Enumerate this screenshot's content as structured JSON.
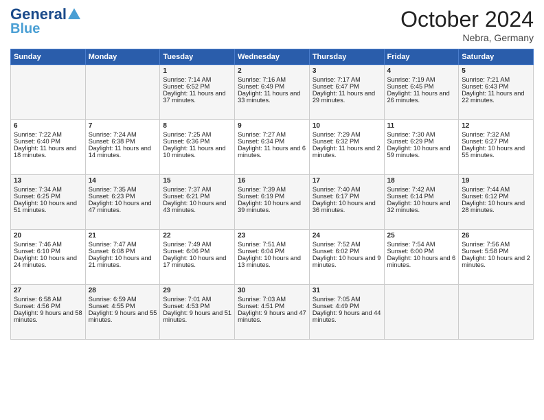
{
  "header": {
    "logo_general": "General",
    "logo_blue": "Blue",
    "month_title": "October 2024",
    "location": "Nebra, Germany"
  },
  "days_of_week": [
    "Sunday",
    "Monday",
    "Tuesday",
    "Wednesday",
    "Thursday",
    "Friday",
    "Saturday"
  ],
  "weeks": [
    {
      "days": [
        {
          "num": "",
          "info": ""
        },
        {
          "num": "",
          "info": ""
        },
        {
          "num": "1",
          "info": "Sunrise: 7:14 AM\nSunset: 6:52 PM\nDaylight: 11 hours and 37 minutes."
        },
        {
          "num": "2",
          "info": "Sunrise: 7:16 AM\nSunset: 6:49 PM\nDaylight: 11 hours and 33 minutes."
        },
        {
          "num": "3",
          "info": "Sunrise: 7:17 AM\nSunset: 6:47 PM\nDaylight: 11 hours and 29 minutes."
        },
        {
          "num": "4",
          "info": "Sunrise: 7:19 AM\nSunset: 6:45 PM\nDaylight: 11 hours and 26 minutes."
        },
        {
          "num": "5",
          "info": "Sunrise: 7:21 AM\nSunset: 6:43 PM\nDaylight: 11 hours and 22 minutes."
        }
      ]
    },
    {
      "days": [
        {
          "num": "6",
          "info": "Sunrise: 7:22 AM\nSunset: 6:40 PM\nDaylight: 11 hours and 18 minutes."
        },
        {
          "num": "7",
          "info": "Sunrise: 7:24 AM\nSunset: 6:38 PM\nDaylight: 11 hours and 14 minutes."
        },
        {
          "num": "8",
          "info": "Sunrise: 7:25 AM\nSunset: 6:36 PM\nDaylight: 11 hours and 10 minutes."
        },
        {
          "num": "9",
          "info": "Sunrise: 7:27 AM\nSunset: 6:34 PM\nDaylight: 11 hours and 6 minutes."
        },
        {
          "num": "10",
          "info": "Sunrise: 7:29 AM\nSunset: 6:32 PM\nDaylight: 11 hours and 2 minutes."
        },
        {
          "num": "11",
          "info": "Sunrise: 7:30 AM\nSunset: 6:29 PM\nDaylight: 10 hours and 59 minutes."
        },
        {
          "num": "12",
          "info": "Sunrise: 7:32 AM\nSunset: 6:27 PM\nDaylight: 10 hours and 55 minutes."
        }
      ]
    },
    {
      "days": [
        {
          "num": "13",
          "info": "Sunrise: 7:34 AM\nSunset: 6:25 PM\nDaylight: 10 hours and 51 minutes."
        },
        {
          "num": "14",
          "info": "Sunrise: 7:35 AM\nSunset: 6:23 PM\nDaylight: 10 hours and 47 minutes."
        },
        {
          "num": "15",
          "info": "Sunrise: 7:37 AM\nSunset: 6:21 PM\nDaylight: 10 hours and 43 minutes."
        },
        {
          "num": "16",
          "info": "Sunrise: 7:39 AM\nSunset: 6:19 PM\nDaylight: 10 hours and 39 minutes."
        },
        {
          "num": "17",
          "info": "Sunrise: 7:40 AM\nSunset: 6:17 PM\nDaylight: 10 hours and 36 minutes."
        },
        {
          "num": "18",
          "info": "Sunrise: 7:42 AM\nSunset: 6:14 PM\nDaylight: 10 hours and 32 minutes."
        },
        {
          "num": "19",
          "info": "Sunrise: 7:44 AM\nSunset: 6:12 PM\nDaylight: 10 hours and 28 minutes."
        }
      ]
    },
    {
      "days": [
        {
          "num": "20",
          "info": "Sunrise: 7:46 AM\nSunset: 6:10 PM\nDaylight: 10 hours and 24 minutes."
        },
        {
          "num": "21",
          "info": "Sunrise: 7:47 AM\nSunset: 6:08 PM\nDaylight: 10 hours and 21 minutes."
        },
        {
          "num": "22",
          "info": "Sunrise: 7:49 AM\nSunset: 6:06 PM\nDaylight: 10 hours and 17 minutes."
        },
        {
          "num": "23",
          "info": "Sunrise: 7:51 AM\nSunset: 6:04 PM\nDaylight: 10 hours and 13 minutes."
        },
        {
          "num": "24",
          "info": "Sunrise: 7:52 AM\nSunset: 6:02 PM\nDaylight: 10 hours and 9 minutes."
        },
        {
          "num": "25",
          "info": "Sunrise: 7:54 AM\nSunset: 6:00 PM\nDaylight: 10 hours and 6 minutes."
        },
        {
          "num": "26",
          "info": "Sunrise: 7:56 AM\nSunset: 5:58 PM\nDaylight: 10 hours and 2 minutes."
        }
      ]
    },
    {
      "days": [
        {
          "num": "27",
          "info": "Sunrise: 6:58 AM\nSunset: 4:56 PM\nDaylight: 9 hours and 58 minutes."
        },
        {
          "num": "28",
          "info": "Sunrise: 6:59 AM\nSunset: 4:55 PM\nDaylight: 9 hours and 55 minutes."
        },
        {
          "num": "29",
          "info": "Sunrise: 7:01 AM\nSunset: 4:53 PM\nDaylight: 9 hours and 51 minutes."
        },
        {
          "num": "30",
          "info": "Sunrise: 7:03 AM\nSunset: 4:51 PM\nDaylight: 9 hours and 47 minutes."
        },
        {
          "num": "31",
          "info": "Sunrise: 7:05 AM\nSunset: 4:49 PM\nDaylight: 9 hours and 44 minutes."
        },
        {
          "num": "",
          "info": ""
        },
        {
          "num": "",
          "info": ""
        }
      ]
    }
  ]
}
